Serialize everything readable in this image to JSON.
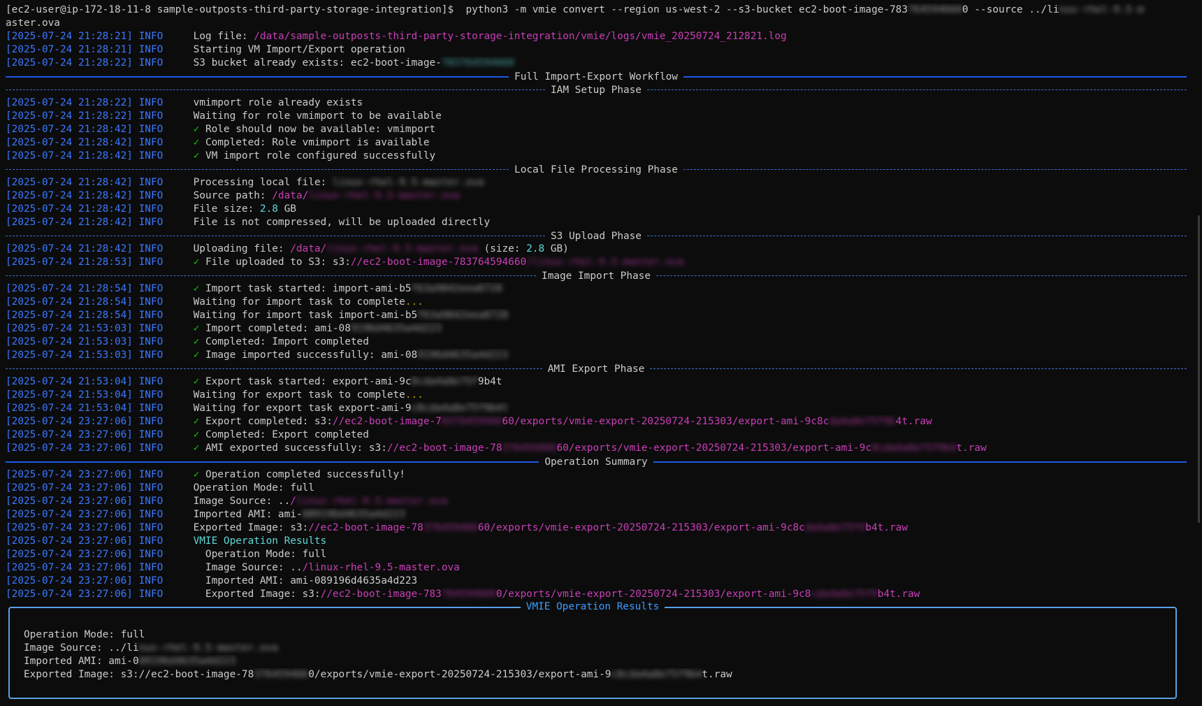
{
  "prompt": {
    "ps1": "[ec2-user@ip-172-18-11-8 sample-outposts-third-party-storage-integration]$",
    "command": "  python3 -m vmie convert --region us-west-2 --s3-bucket ec2-boot-image-783",
    "command_redacted": "764594660",
    "command_tail": "0 --source ../li",
    "command_tail_redacted": "nux-rhel-9.5-m",
    "wrap": "aster.ova"
  },
  "level": "INFO",
  "lines": [
    {
      "kind": "log",
      "ts": "[2025-07-24 21:28:21]",
      "parts": [
        {
          "t": "Log file: "
        },
        {
          "t": "/data/sample-outposts-third-party-storage-integration/vmie/logs/vmie_20250724_212821.log",
          "c": "path"
        }
      ]
    },
    {
      "kind": "log",
      "ts": "[2025-07-24 21:28:21]",
      "parts": [
        {
          "t": "Starting VM Import/Export operation"
        }
      ]
    },
    {
      "kind": "log",
      "ts": "[2025-07-24 21:28:22]",
      "parts": [
        {
          "t": "S3 bucket already exists: ec2-boot-image-"
        },
        {
          "t": "783764594660",
          "c": "cyan",
          "blur": true
        }
      ]
    },
    {
      "kind": "rule",
      "style": "solid",
      "title": "Full Import-Export Workflow"
    },
    {
      "kind": "rule",
      "style": "dashed",
      "title": "IAM Setup Phase"
    },
    {
      "kind": "log",
      "ts": "[2025-07-24 21:28:22]",
      "parts": [
        {
          "t": "vmimport role already exists"
        }
      ]
    },
    {
      "kind": "log",
      "ts": "[2025-07-24 21:28:22]",
      "parts": [
        {
          "t": "Waiting for role vmimport to be available"
        }
      ]
    },
    {
      "kind": "log",
      "ts": "[2025-07-24 21:28:42]",
      "parts": [
        {
          "t": "✓",
          "c": "check"
        },
        {
          "t": " Role should now be available: vmimport"
        }
      ]
    },
    {
      "kind": "log",
      "ts": "[2025-07-24 21:28:42]",
      "parts": [
        {
          "t": "✓",
          "c": "check"
        },
        {
          "t": " Completed: Role vmimport is available"
        }
      ]
    },
    {
      "kind": "log",
      "ts": "[2025-07-24 21:28:42]",
      "parts": [
        {
          "t": "✓",
          "c": "check"
        },
        {
          "t": " VM import role configured successfully"
        }
      ]
    },
    {
      "kind": "rule",
      "style": "dashed",
      "title": "Local File Processing Phase"
    },
    {
      "kind": "log",
      "ts": "[2025-07-24 21:28:42]",
      "parts": [
        {
          "t": "Processing local file: "
        },
        {
          "t": "linux-rhel-9.5-master.ova",
          "blur": true
        }
      ]
    },
    {
      "kind": "log",
      "ts": "[2025-07-24 21:28:42]",
      "parts": [
        {
          "t": "Source path: "
        },
        {
          "t": "/data/",
          "c": "path"
        },
        {
          "t": "linux-rhel-9.5-master.ova",
          "c": "path",
          "blur": true
        }
      ]
    },
    {
      "kind": "log",
      "ts": "[2025-07-24 21:28:42]",
      "parts": [
        {
          "t": "File size: "
        },
        {
          "t": "2.8",
          "c": "num"
        },
        {
          "t": " GB"
        }
      ]
    },
    {
      "kind": "log",
      "ts": "[2025-07-24 21:28:42]",
      "parts": [
        {
          "t": "File is not compressed, will be uploaded directly"
        }
      ]
    },
    {
      "kind": "rule",
      "style": "dashed",
      "title": "S3 Upload Phase"
    },
    {
      "kind": "log",
      "ts": "[2025-07-24 21:28:42]",
      "parts": [
        {
          "t": "Uploading file: "
        },
        {
          "t": "/data/",
          "c": "path"
        },
        {
          "t": "linux-rhel-9.5-master.ova",
          "c": "path",
          "blur": true
        },
        {
          "t": " (size: "
        },
        {
          "t": "2.8",
          "c": "num"
        },
        {
          "t": " GB)"
        }
      ]
    },
    {
      "kind": "log",
      "ts": "[2025-07-24 21:28:53]",
      "parts": [
        {
          "t": "✓",
          "c": "check"
        },
        {
          "t": " File uploaded to S3: s3:"
        },
        {
          "t": "//ec2-boot-image-783764594660",
          "c": "path"
        },
        {
          "t": "/linux-rhel-9.5-master.ova",
          "c": "path",
          "blur": true
        }
      ]
    },
    {
      "kind": "rule",
      "style": "dashed",
      "title": "Image Import Phase"
    },
    {
      "kind": "log",
      "ts": "[2025-07-24 21:28:54]",
      "parts": [
        {
          "t": "✓",
          "c": "check"
        },
        {
          "t": " Import task started: import-ami-b5"
        },
        {
          "t": "f63a9842eea8728",
          "blur": true
        }
      ]
    },
    {
      "kind": "log",
      "ts": "[2025-07-24 21:28:54]",
      "parts": [
        {
          "t": "Waiting for import task to complete"
        },
        {
          "t": "...",
          "c": "dots"
        }
      ]
    },
    {
      "kind": "log",
      "ts": "[2025-07-24 21:28:54]",
      "parts": [
        {
          "t": "Waiting for import task import-ami-b5"
        },
        {
          "t": "f63a9842eea8728",
          "blur": true
        }
      ]
    },
    {
      "kind": "log",
      "ts": "[2025-07-24 21:53:03]",
      "parts": [
        {
          "t": "✓",
          "c": "check"
        },
        {
          "t": " Import completed: ami-08"
        },
        {
          "t": "9196d4635a4d223",
          "blur": true
        }
      ]
    },
    {
      "kind": "log",
      "ts": "[2025-07-24 21:53:03]",
      "parts": [
        {
          "t": "✓",
          "c": "check"
        },
        {
          "t": " Completed: Import completed"
        }
      ]
    },
    {
      "kind": "log",
      "ts": "[2025-07-24 21:53:03]",
      "parts": [
        {
          "t": "✓",
          "c": "check"
        },
        {
          "t": " Image imported successfully: ami-08"
        },
        {
          "t": "9196d4635a4d223",
          "blur": true
        }
      ]
    },
    {
      "kind": "rule",
      "style": "dashed",
      "title": "AMI Export Phase"
    },
    {
      "kind": "log",
      "ts": "[2025-07-24 21:53:04]",
      "parts": [
        {
          "t": "✓",
          "c": "check"
        },
        {
          "t": " Export task started: export-ami-9c"
        },
        {
          "t": "8cda4a8e75f",
          "blur": true
        },
        {
          "t": "9b4t"
        }
      ]
    },
    {
      "kind": "log",
      "ts": "[2025-07-24 21:53:04]",
      "parts": [
        {
          "t": "Waiting for export task to complete"
        },
        {
          "t": "...",
          "c": "dots"
        }
      ]
    },
    {
      "kind": "log",
      "ts": "[2025-07-24 21:53:04]",
      "parts": [
        {
          "t": "Waiting for export task export-ami-9"
        },
        {
          "t": "c8cda4a8e75f9b4t",
          "blur": true
        }
      ]
    },
    {
      "kind": "log",
      "ts": "[2025-07-24 23:27:06]",
      "parts": [
        {
          "t": "✓",
          "c": "check"
        },
        {
          "t": " Export completed: s3:"
        },
        {
          "t": "//ec2-boot-image-7",
          "c": "path"
        },
        {
          "t": "8376459466",
          "c": "path",
          "blur": true
        },
        {
          "t": "60/exports/vmie-export-20250724-215303/export-ami-9c8c",
          "c": "path"
        },
        {
          "t": "da4a8e75f9b",
          "c": "path",
          "blur": true
        },
        {
          "t": "4t.raw",
          "c": "path"
        }
      ]
    },
    {
      "kind": "log",
      "ts": "[2025-07-24 23:27:06]",
      "parts": [
        {
          "t": "✓",
          "c": "check"
        },
        {
          "t": " Completed: Export completed"
        }
      ]
    },
    {
      "kind": "log",
      "ts": "[2025-07-24 23:27:06]",
      "parts": [
        {
          "t": "✓",
          "c": "check"
        },
        {
          "t": " AMI exported successfully: s3:"
        },
        {
          "t": "//ec2-boot-image-78",
          "c": "path"
        },
        {
          "t": "376459466",
          "c": "path",
          "blur": true
        },
        {
          "t": "60/exports/vmie-export-20250724-215303/export-ami-9c",
          "c": "path"
        },
        {
          "t": "8cda4a8e75f9b4",
          "c": "path",
          "blur": true
        },
        {
          "t": "t.raw",
          "c": "path"
        }
      ]
    },
    {
      "kind": "rule",
      "style": "solid",
      "title": "Operation Summary"
    },
    {
      "kind": "log",
      "ts": "[2025-07-24 23:27:06]",
      "parts": [
        {
          "t": "✓",
          "c": "check"
        },
        {
          "t": " Operation completed successfully!"
        }
      ]
    },
    {
      "kind": "log",
      "ts": "[2025-07-24 23:27:06]",
      "parts": [
        {
          "t": "Operation Mode: full"
        }
      ]
    },
    {
      "kind": "log",
      "ts": "[2025-07-24 23:27:06]",
      "parts": [
        {
          "t": "Image Source: .."
        },
        {
          "t": "/",
          "c": "path"
        },
        {
          "t": "linux-rhel-9.5-master.ova",
          "c": "path",
          "blur": true
        }
      ]
    },
    {
      "kind": "log",
      "ts": "[2025-07-24 23:27:06]",
      "parts": [
        {
          "t": "Imported AMI: ami-"
        },
        {
          "t": "089196d4635a4d223",
          "blur": true
        }
      ]
    },
    {
      "kind": "log",
      "ts": "[2025-07-24 23:27:06]",
      "parts": [
        {
          "t": "Exported Image: s3:"
        },
        {
          "t": "//ec2-boot-image-78",
          "c": "path"
        },
        {
          "t": "376459466",
          "c": "path",
          "blur": true
        },
        {
          "t": "60/exports/vmie-export-20250724-215303/export-ami-9c8c",
          "c": "path"
        },
        {
          "t": "da4a8e75f9",
          "c": "path",
          "blur": true
        },
        {
          "t": "b4t.raw",
          "c": "path"
        }
      ]
    },
    {
      "kind": "log",
      "ts": "[2025-07-24 23:27:06]",
      "parts": [
        {
          "t": "VMIE Operation Results",
          "c": "cyan"
        }
      ]
    },
    {
      "kind": "log",
      "ts": "[2025-07-24 23:27:06]",
      "parts": [
        {
          "t": "  Operation Mode: full"
        }
      ]
    },
    {
      "kind": "log",
      "ts": "[2025-07-24 23:27:06]",
      "parts": [
        {
          "t": "  Image Source: .."
        },
        {
          "t": "/linux-rhel-9.5-master.ova",
          "c": "path"
        }
      ]
    },
    {
      "kind": "log",
      "ts": "[2025-07-24 23:27:06]",
      "parts": [
        {
          "t": "  Imported AMI: ami-089196d4635a4d223"
        }
      ]
    },
    {
      "kind": "log",
      "ts": "[2025-07-24 23:27:06]",
      "parts": [
        {
          "t": "  Exported Image: s3:"
        },
        {
          "t": "//ec2-boot-image-783",
          "c": "path"
        },
        {
          "t": "764594660",
          "c": "path",
          "blur": true
        },
        {
          "t": "0/exports/vmie-export-20250724-215303/export-ami-9c8",
          "c": "path"
        },
        {
          "t": "cda4a8e75f9",
          "c": "path",
          "blur": true
        },
        {
          "t": "b4t.raw",
          "c": "path"
        }
      ]
    }
  ],
  "panel": {
    "title": "VMIE Operation Results",
    "rows": [
      [
        {
          "t": "Operation Mode: full"
        }
      ],
      [
        {
          "t": "Image Source: ../li"
        },
        {
          "t": "nux-rhel-9.5-master.ova",
          "blur": true
        }
      ],
      [
        {
          "t": "Imported AMI: ami-0"
        },
        {
          "t": "89196d4635a4d223",
          "blur": true
        }
      ],
      [
        {
          "t": "Exported Image: s3://ec2-boot-image-78"
        },
        {
          "t": "376459466",
          "blur": true
        },
        {
          "t": "0/exports/vmie-export-20250724-215303/export-ami-9"
        },
        {
          "t": "c8cda4a8e75f9b4",
          "blur": true
        },
        {
          "t": "t.raw"
        }
      ]
    ]
  }
}
